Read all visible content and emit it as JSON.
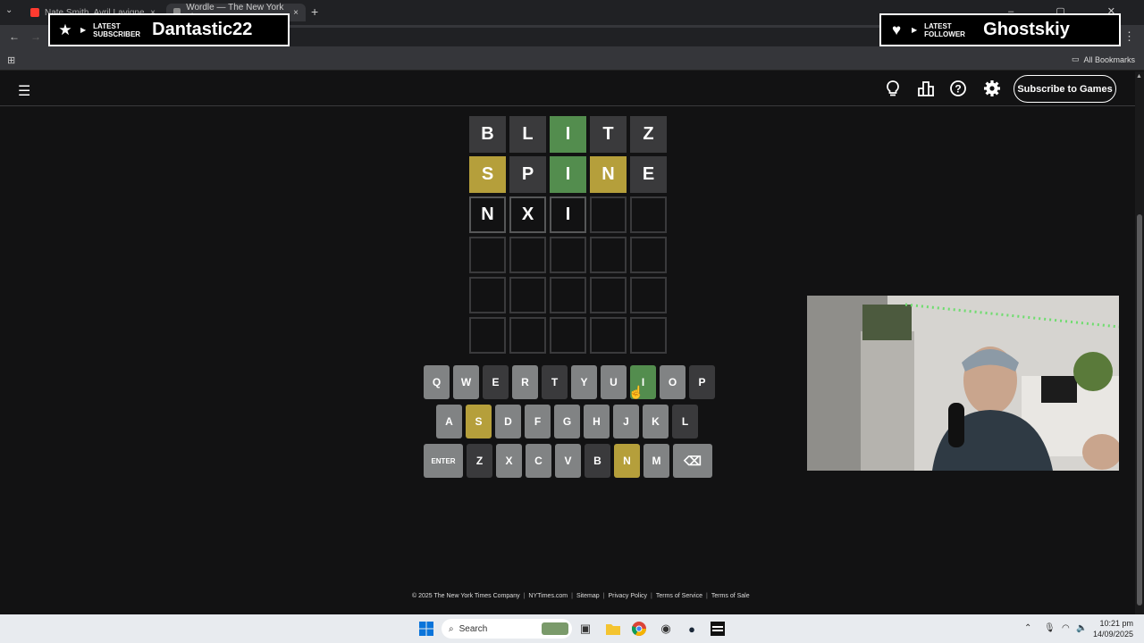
{
  "browser": {
    "tabs": [
      {
        "label": "Nate Smith, Avril Lavigne",
        "favicon_color": "#ff3b30",
        "close": "×"
      },
      {
        "label": "Wordle — The New York Times",
        "favicon_color": "#888888",
        "close": "×"
      }
    ],
    "new_tab": "+",
    "bookmarks_label": "All Bookmarks"
  },
  "overlays": {
    "subscriber": {
      "label_line1": "LATEST",
      "label_line2": "SUBSCRIBER",
      "name": "Dantastic22",
      "icon": "star-icon"
    },
    "follower": {
      "label_line1": "LATEST",
      "label_line2": "FOLLOWER",
      "name": "Ghostskiy",
      "icon": "heart-icon"
    }
  },
  "header": {
    "subscribe_label": "Subscribe to Games",
    "icons": [
      "hint-lightbulb-icon",
      "stats-icon",
      "help-icon",
      "settings-gear-icon"
    ]
  },
  "board": {
    "rows": [
      [
        {
          "l": "B",
          "s": "absent"
        },
        {
          "l": "L",
          "s": "absent"
        },
        {
          "l": "I",
          "s": "correct"
        },
        {
          "l": "T",
          "s": "absent"
        },
        {
          "l": "Z",
          "s": "absent"
        }
      ],
      [
        {
          "l": "S",
          "s": "present"
        },
        {
          "l": "P",
          "s": "absent"
        },
        {
          "l": "I",
          "s": "correct"
        },
        {
          "l": "N",
          "s": "present"
        },
        {
          "l": "E",
          "s": "absent"
        }
      ],
      [
        {
          "l": "N",
          "s": "tbd"
        },
        {
          "l": "X",
          "s": "tbd"
        },
        {
          "l": "I",
          "s": "tbd"
        },
        {
          "l": "",
          "s": "empty"
        },
        {
          "l": "",
          "s": "empty"
        }
      ],
      [
        {
          "l": "",
          "s": "empty"
        },
        {
          "l": "",
          "s": "empty"
        },
        {
          "l": "",
          "s": "empty"
        },
        {
          "l": "",
          "s": "empty"
        },
        {
          "l": "",
          "s": "empty"
        }
      ],
      [
        {
          "l": "",
          "s": "empty"
        },
        {
          "l": "",
          "s": "empty"
        },
        {
          "l": "",
          "s": "empty"
        },
        {
          "l": "",
          "s": "empty"
        },
        {
          "l": "",
          "s": "empty"
        }
      ],
      [
        {
          "l": "",
          "s": "empty"
        },
        {
          "l": "",
          "s": "empty"
        },
        {
          "l": "",
          "s": "empty"
        },
        {
          "l": "",
          "s": "empty"
        },
        {
          "l": "",
          "s": "empty"
        }
      ]
    ]
  },
  "keyboard": {
    "rows": [
      [
        {
          "k": "Q",
          "s": "unused"
        },
        {
          "k": "W",
          "s": "unused"
        },
        {
          "k": "E",
          "s": "absent"
        },
        {
          "k": "R",
          "s": "unused"
        },
        {
          "k": "T",
          "s": "absent"
        },
        {
          "k": "Y",
          "s": "unused"
        },
        {
          "k": "U",
          "s": "unused"
        },
        {
          "k": "I",
          "s": "correct"
        },
        {
          "k": "O",
          "s": "unused"
        },
        {
          "k": "P",
          "s": "absent"
        }
      ],
      [
        {
          "k": "A",
          "s": "unused"
        },
        {
          "k": "S",
          "s": "present"
        },
        {
          "k": "D",
          "s": "unused"
        },
        {
          "k": "F",
          "s": "unused"
        },
        {
          "k": "G",
          "s": "unused"
        },
        {
          "k": "H",
          "s": "unused"
        },
        {
          "k": "J",
          "s": "unused"
        },
        {
          "k": "K",
          "s": "unused"
        },
        {
          "k": "L",
          "s": "absent"
        }
      ],
      [
        {
          "k": "ENTER",
          "s": "unused",
          "wide": true
        },
        {
          "k": "Z",
          "s": "absent"
        },
        {
          "k": "X",
          "s": "unused"
        },
        {
          "k": "C",
          "s": "unused"
        },
        {
          "k": "V",
          "s": "unused"
        },
        {
          "k": "B",
          "s": "absent"
        },
        {
          "k": "N",
          "s": "present"
        },
        {
          "k": "M",
          "s": "unused"
        },
        {
          "k": "⌫",
          "s": "unused",
          "wide": true
        }
      ]
    ]
  },
  "footer": {
    "links": [
      "© 2025 The New York Times Company",
      "NYTimes.com",
      "Sitemap",
      "Privacy Policy",
      "Terms of Service",
      "Terms of Sale"
    ]
  },
  "taskbar": {
    "search_placeholder": "Search",
    "time": "10:21 pm",
    "date": "14/09/2025"
  },
  "colors": {
    "correct": "#538d4e",
    "present": "#b59f3b",
    "absent": "#3a3a3c",
    "unused_key": "#818384",
    "background": "#121213"
  }
}
